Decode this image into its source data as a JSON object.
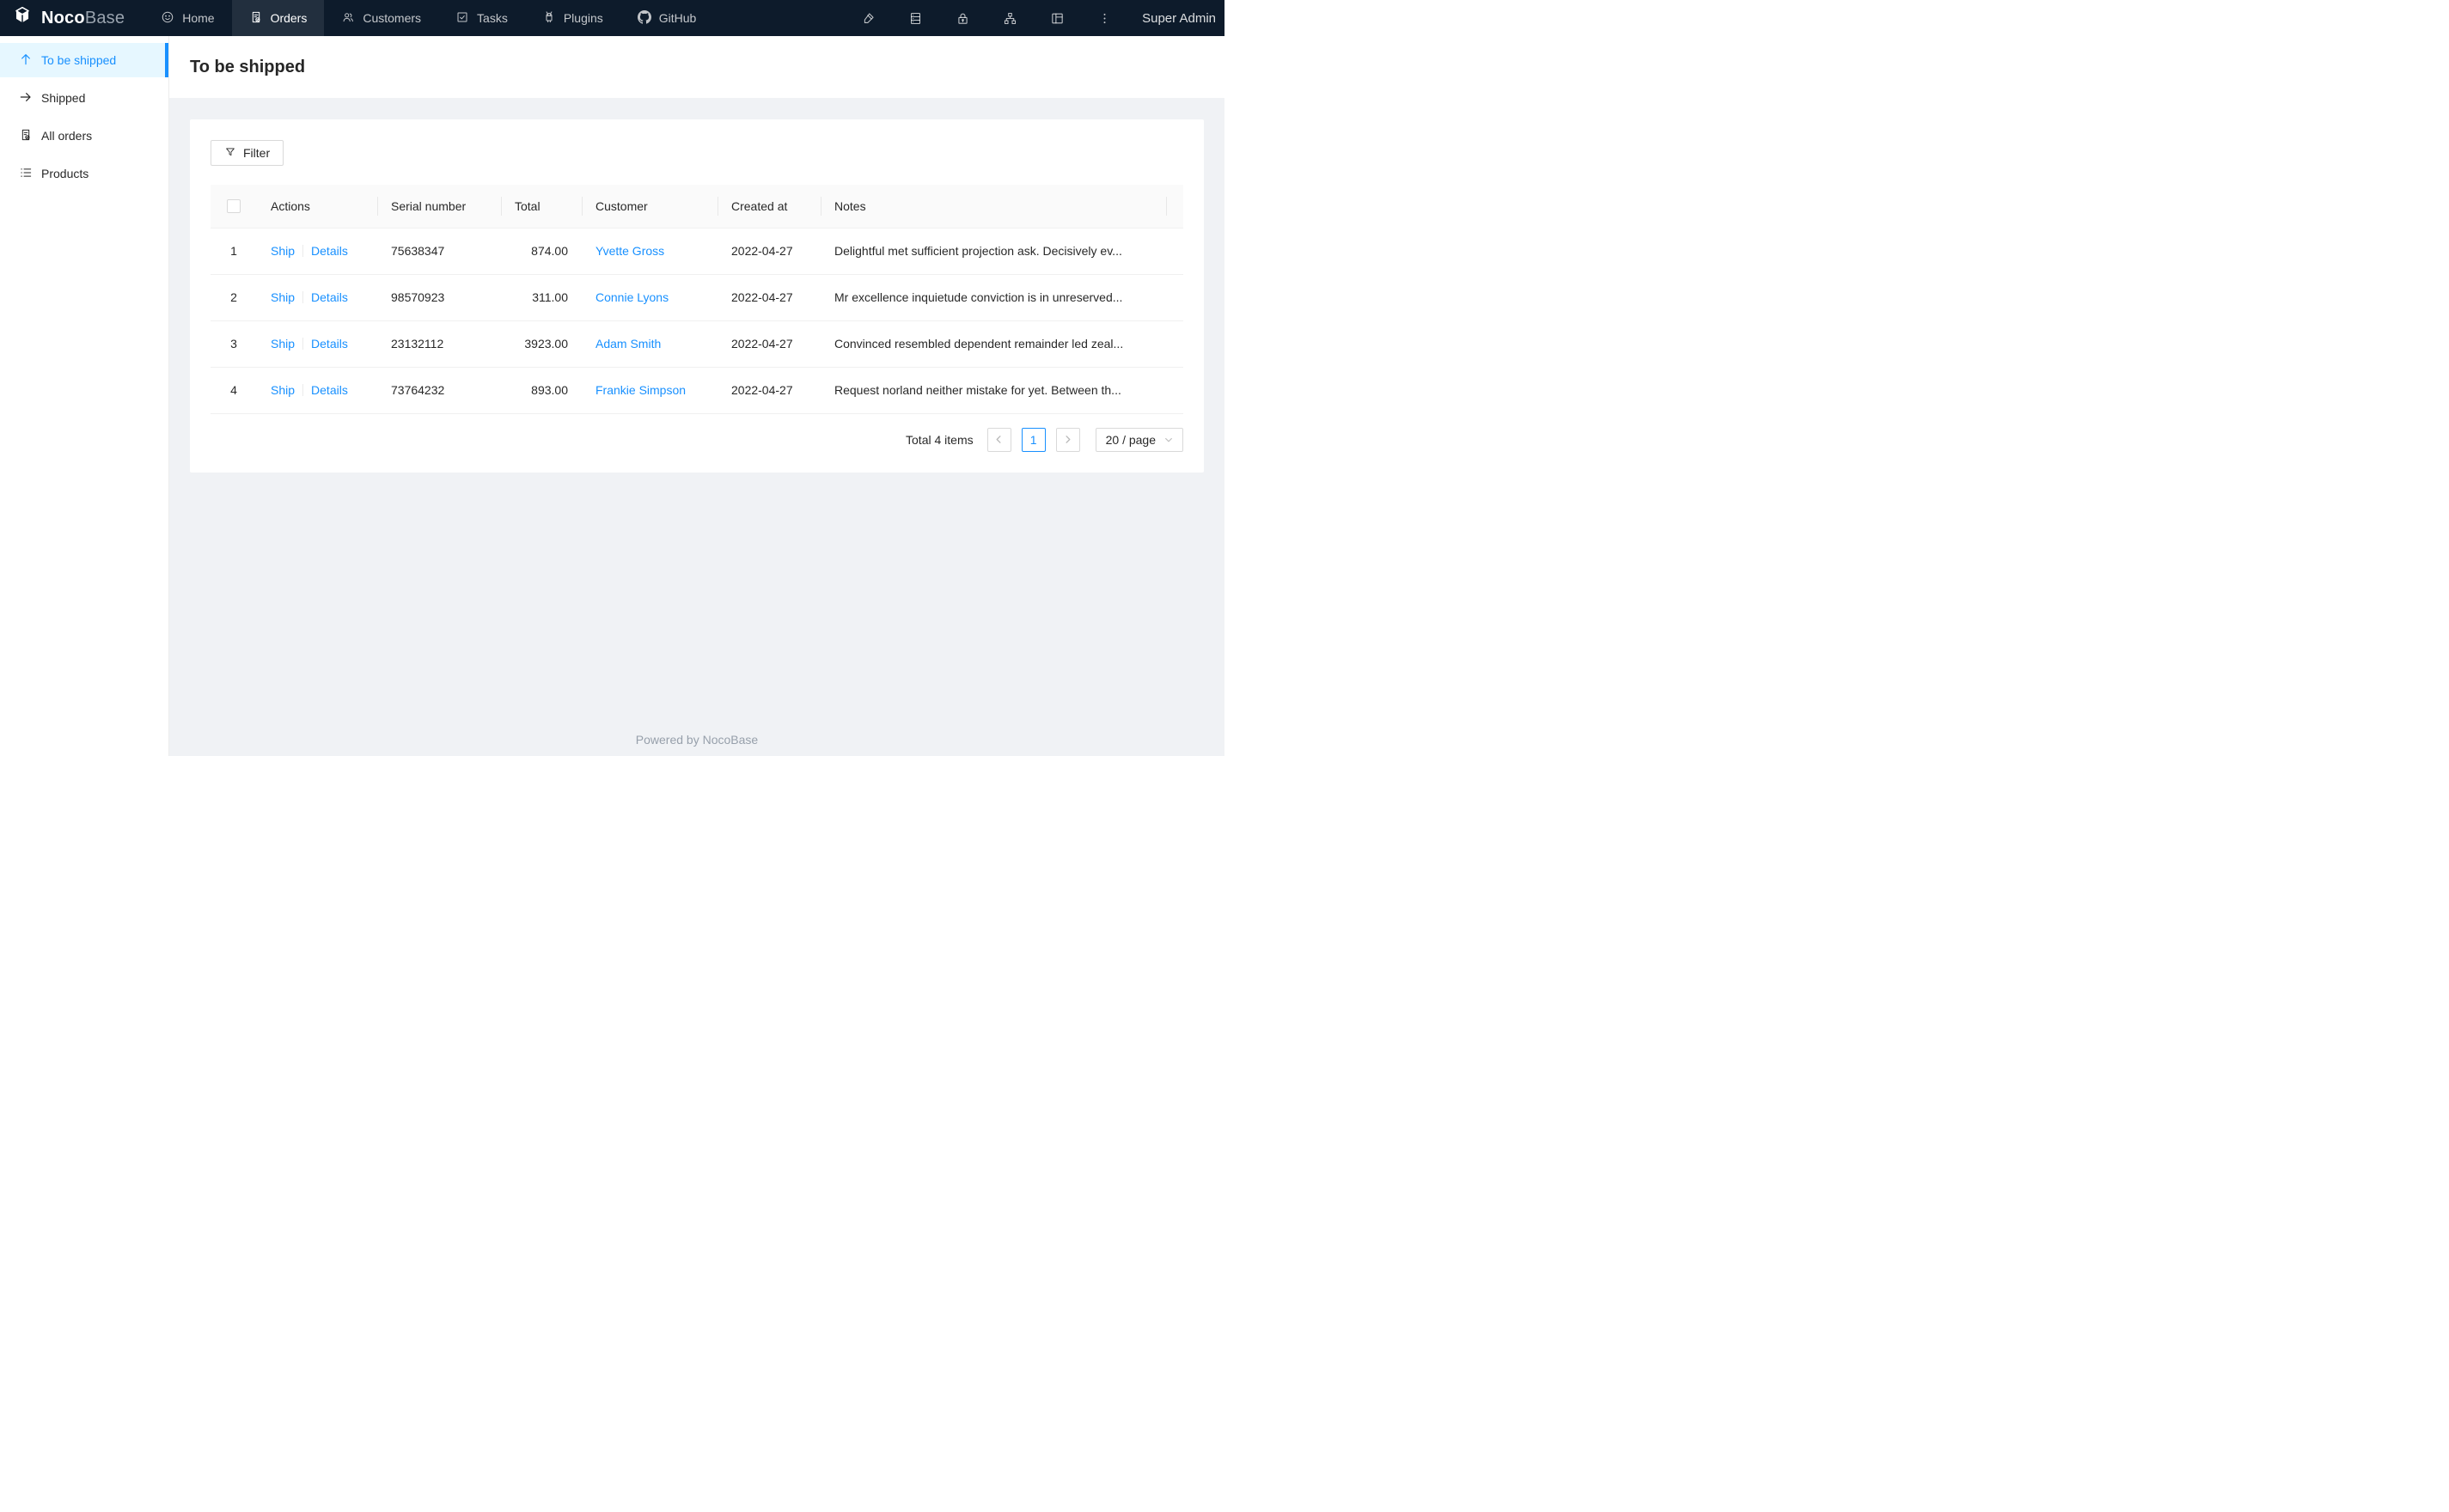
{
  "colors": {
    "accent": "#1890ff",
    "topnav_bg": "#0d1b2b",
    "topnav_active_bg": "rgba(255,255,255,0.09)",
    "sidebar_active_bg": "#e6f7ff",
    "body_bg": "#f0f2f5",
    "table_header_bg": "#fafafa",
    "border": "#f0f0f0"
  },
  "topnav": {
    "logo_bold": "Noco",
    "logo_light": "Base",
    "items": [
      {
        "label": "Home",
        "icon": "smiley-icon",
        "active": false
      },
      {
        "label": "Orders",
        "icon": "file-done-icon",
        "active": true
      },
      {
        "label": "Customers",
        "icon": "team-icon",
        "active": false
      },
      {
        "label": "Tasks",
        "icon": "check-square-icon",
        "active": false
      },
      {
        "label": "Plugins",
        "icon": "android-icon",
        "active": false
      },
      {
        "label": "GitHub",
        "icon": "github-icon",
        "active": false
      }
    ],
    "right_icons": [
      "highlight-icon",
      "database-icon",
      "lock-icon",
      "apartment-icon",
      "layout-icon",
      "ellipsis-icon"
    ],
    "user_label": "Super Admin"
  },
  "sidebar": {
    "items": [
      {
        "label": "To be shipped",
        "icon": "arrow-up-icon",
        "active": true
      },
      {
        "label": "Shipped",
        "icon": "arrow-right-icon",
        "active": false
      },
      {
        "label": "All orders",
        "icon": "file-done-icon",
        "active": false
      },
      {
        "label": "Products",
        "icon": "unordered-list-icon",
        "active": false
      }
    ]
  },
  "page": {
    "title": "To be shipped"
  },
  "toolbar": {
    "filter_label": "Filter"
  },
  "table": {
    "columns": {
      "actions": "Actions",
      "serial": "Serial number",
      "total": "Total",
      "customer": "Customer",
      "created_at": "Created at",
      "notes": "Notes"
    },
    "rows": [
      {
        "index": "1",
        "action_ship": "Ship",
        "action_details": "Details",
        "serial": "75638347",
        "total": "874.00",
        "customer": "Yvette Gross",
        "created_at": "2022-04-27",
        "notes": "Delightful met sufficient projection ask. Decisively ev..."
      },
      {
        "index": "2",
        "action_ship": "Ship",
        "action_details": "Details",
        "serial": "98570923",
        "total": "311.00",
        "customer": "Connie Lyons",
        "created_at": "2022-04-27",
        "notes": "Mr excellence inquietude conviction is in unreserved..."
      },
      {
        "index": "3",
        "action_ship": "Ship",
        "action_details": "Details",
        "serial": "23132112",
        "total": "3923.00",
        "customer": "Adam Smith",
        "created_at": "2022-04-27",
        "notes": "Convinced resembled dependent remainder led zeal..."
      },
      {
        "index": "4",
        "action_ship": "Ship",
        "action_details": "Details",
        "serial": "73764232",
        "total": "893.00",
        "customer": "Frankie Simpson",
        "created_at": "2022-04-27",
        "notes": "Request norland neither mistake for yet. Between th..."
      }
    ]
  },
  "pagination": {
    "total_text": "Total 4 items",
    "current_page": "1",
    "page_size": "20 / page"
  },
  "footer": {
    "text": "Powered by NocoBase"
  }
}
